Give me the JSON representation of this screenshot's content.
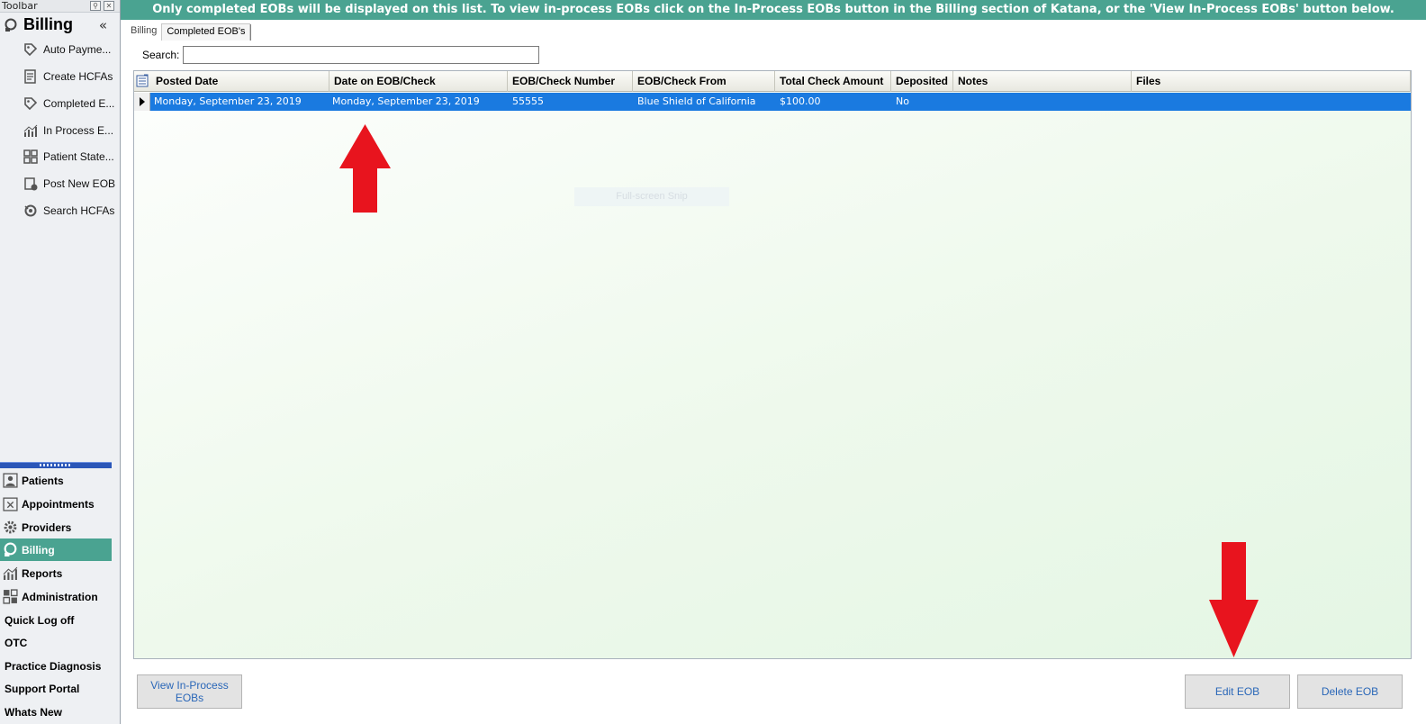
{
  "toolbar": {
    "caption": "Toolbar",
    "header_title": "Billing",
    "collapse_glyph": "«",
    "items": [
      {
        "label": "Auto Payme...",
        "icon": "tag-icon"
      },
      {
        "label": "Create HCFAs",
        "icon": "form-icon"
      },
      {
        "label": "Completed E...",
        "icon": "tag-icon"
      },
      {
        "label": "In Process E...",
        "icon": "chart-icon"
      },
      {
        "label": "Patient State...",
        "icon": "grid-icon"
      },
      {
        "label": "Post New EOB",
        "icon": "post-icon"
      },
      {
        "label": "Search HCFAs",
        "icon": "search-form-icon"
      }
    ]
  },
  "nav": {
    "items": [
      {
        "label": "Patients",
        "icon": "patients-icon",
        "active": false
      },
      {
        "label": "Appointments",
        "icon": "calendar-icon",
        "active": false
      },
      {
        "label": "Providers",
        "icon": "gear-icon",
        "active": false
      },
      {
        "label": "Billing",
        "icon": "billing-icon",
        "active": true
      },
      {
        "label": "Reports",
        "icon": "reports-icon",
        "active": false
      },
      {
        "label": "Administration",
        "icon": "admin-icon",
        "active": false
      },
      {
        "label": "Quick Log off",
        "icon": "",
        "active": false
      },
      {
        "label": "OTC",
        "icon": "",
        "active": false
      },
      {
        "label": "Practice Diagnosis",
        "icon": "",
        "active": false
      },
      {
        "label": "Support Portal",
        "icon": "",
        "active": false
      },
      {
        "label": "Whats New",
        "icon": "",
        "active": false
      }
    ]
  },
  "banner": "Only completed EOBs will be displayed on this list. To view in-process EOBs click on the In-Process EOBs button in the Billing section of Katana, or the 'View In-Process EOBs' button below.",
  "tabs": [
    {
      "label": "Billing",
      "active": false
    },
    {
      "label": "Completed EOB's",
      "active": true
    }
  ],
  "search": {
    "label": "Search:",
    "value": ""
  },
  "grid": {
    "columns": [
      "Posted Date",
      "Date on EOB/Check",
      "EOB/Check Number",
      "EOB/Check From",
      "Total Check Amount",
      "Deposited",
      "Notes",
      "Files"
    ],
    "rows": [
      [
        "Monday, September 23, 2019",
        "Monday, September 23, 2019",
        "55555",
        "Blue Shield of California",
        "$100.00",
        "No",
        "",
        ""
      ]
    ]
  },
  "overlay": "Full-screen Snip",
  "buttons": {
    "view_inprocess": "View In-Process EOBs",
    "edit": "Edit EOB",
    "delete": "Delete EOB"
  },
  "colors": {
    "accent": "#4aa391",
    "selection": "#1a7ae0",
    "annotation_arrow": "#e8141e"
  }
}
